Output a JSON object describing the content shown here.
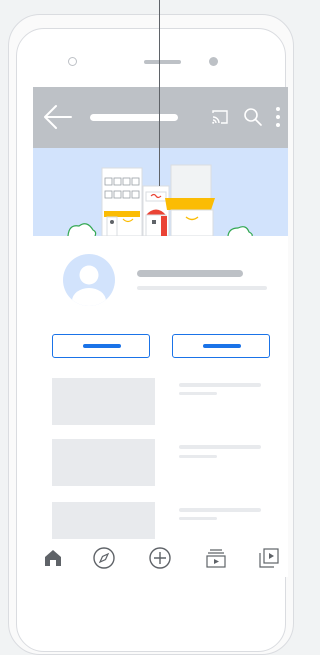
{
  "app": {
    "appbar": {
      "icons": [
        "arrow-back-icon",
        "cast-icon",
        "search-icon",
        "more-vert-icon"
      ]
    },
    "banner": {
      "illustration": "city-storefront-illustration"
    },
    "profile": {
      "avatar": "account-circle-icon"
    },
    "buttons": {
      "count": 2
    },
    "list": {
      "items": 3
    },
    "bottom_nav": {
      "icons": [
        "home-icon",
        "explore-icon",
        "add-circle-icon",
        "subscriptions-icon",
        "library-icon"
      ]
    }
  },
  "colors": {
    "appbar": "#bdc1c6",
    "banner": "#d2e3fc",
    "accent": "#1a73e8",
    "placeholder": "#e8eaed"
  }
}
